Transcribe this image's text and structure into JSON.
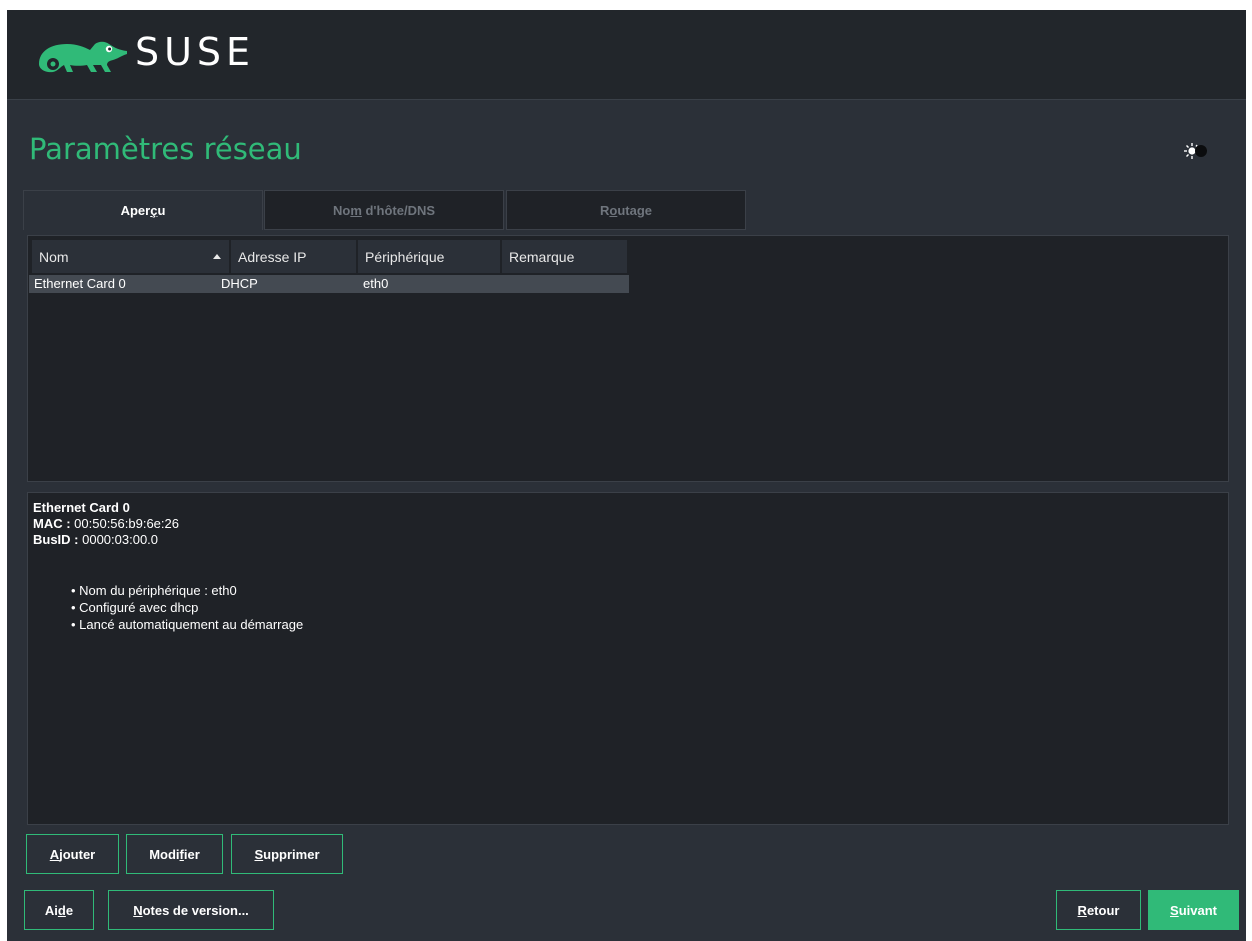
{
  "brand": {
    "name": "SUSE"
  },
  "page": {
    "title": "Paramètres réseau"
  },
  "tabs": [
    {
      "pre": "Aper",
      "ul": "ç",
      "post": "u",
      "active": true
    },
    {
      "pre": "No",
      "ul": "m",
      "post": " d'hôte/DNS",
      "active": false
    },
    {
      "pre": "R",
      "ul": "o",
      "post": "utage",
      "active": false
    }
  ],
  "table": {
    "columns": [
      "Nom",
      "Adresse IP",
      "Périphérique",
      "Remarque"
    ],
    "sort_column": "Nom",
    "rows": [
      {
        "nom": "Ethernet Card 0",
        "ip": "DHCP",
        "device": "eth0",
        "remark": ""
      }
    ]
  },
  "details": {
    "title": "Ethernet Card 0",
    "mac_label": "MAC :",
    "mac_value": " 00:50:56:b9:6e:26",
    "busid_label": "BusID :",
    "busid_value": " 0000:03:00.0",
    "bullets": [
      "Nom du périphérique : eth0",
      "Configuré avec dhcp",
      "Lancé automatiquement au démarrage"
    ]
  },
  "buttons": {
    "add": {
      "pre": "",
      "ul": "A",
      "post": "jouter"
    },
    "edit": {
      "pre": "Modi",
      "ul": "f",
      "post": "ier"
    },
    "delete": {
      "pre": "",
      "ul": "S",
      "post": "upprimer"
    },
    "help": {
      "pre": "Ai",
      "ul": "d",
      "post": "e"
    },
    "release_notes": {
      "pre": "",
      "ul": "N",
      "post": "otes de version..."
    },
    "back": {
      "pre": "",
      "ul": "R",
      "post": "etour"
    },
    "next": {
      "pre": "",
      "ul": "S",
      "post": "uivant"
    }
  },
  "colors": {
    "accent": "#30ba78",
    "topbar": "#22262b",
    "background": "#2b3038",
    "panel": "#1f2227",
    "selected_row": "#444a52"
  },
  "icons": {
    "logo": "suse-chameleon-icon",
    "theme": "theme-toggle-icon",
    "sort": "sort-ascending-icon"
  }
}
